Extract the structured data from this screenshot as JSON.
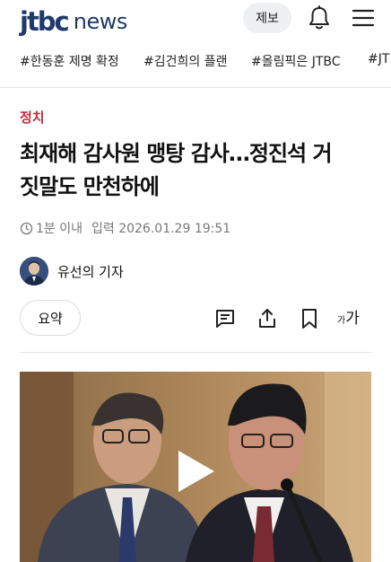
{
  "header": {
    "logo_jtbc": "jtbc",
    "logo_news": "news",
    "report_label": "제보",
    "bell_icon": "bell-icon",
    "menu_icon": "hamburger-menu-icon"
  },
  "hashtags": [
    "#한동훈 제명 확정",
    "#김건희의 플랜",
    "#올림픽은 JTBC",
    "#JT"
  ],
  "article": {
    "section": "정치",
    "headline_line1": "최재해 감사원 맹탕 감사…정진석 거",
    "headline_line2": "짓말도 만천하에",
    "read_time": "1분 이내",
    "published": "입력 2026.01.29 19:51",
    "reporter": "유선의 기자"
  },
  "toolbar": {
    "summary_label": "요약",
    "font_small": "가",
    "font_large": "가",
    "comment_icon": "comment-icon",
    "share_icon": "share-icon",
    "bookmark_icon": "bookmark-icon"
  },
  "video": {
    "play_icon": "play-icon"
  },
  "colors": {
    "brand": "#1f3a6b",
    "section": "#c22a3a"
  }
}
